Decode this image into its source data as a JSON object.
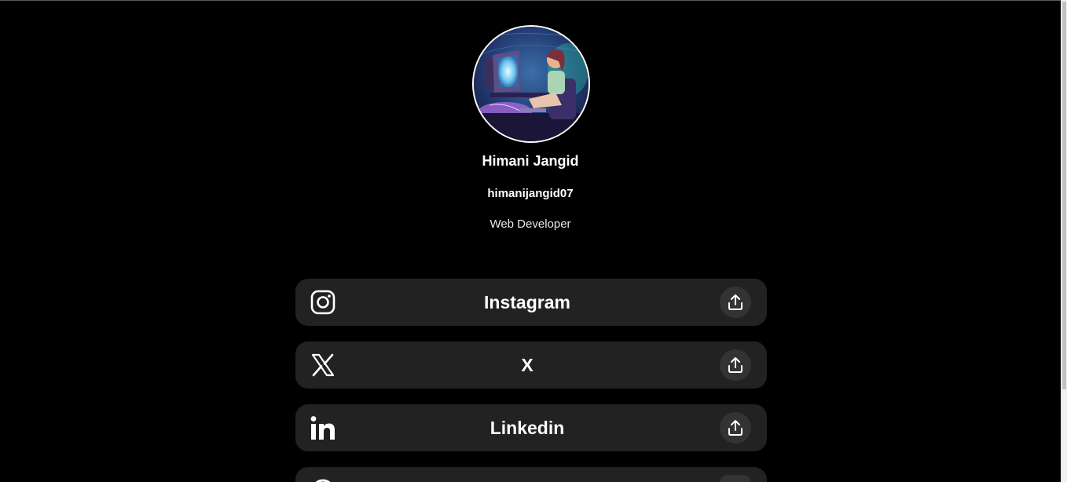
{
  "profile": {
    "name": "Himani Jangid",
    "username": "himanijangid07",
    "bio": "Web Developer"
  },
  "links": [
    {
      "label": "Instagram",
      "icon": "instagram-icon"
    },
    {
      "label": "X",
      "icon": "x-icon"
    },
    {
      "label": "Linkedin",
      "icon": "linkedin-icon"
    },
    {
      "label": "",
      "icon": "link-icon"
    }
  ],
  "share_icon": "share-icon",
  "colors": {
    "background": "#000000",
    "card": "#222222",
    "share_button": "#333333",
    "text": "#ffffff"
  }
}
